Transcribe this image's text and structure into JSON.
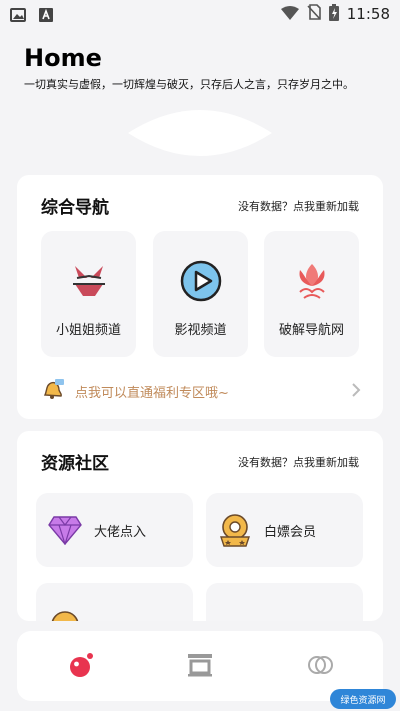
{
  "status_bar": {
    "time": "11:58",
    "icons": [
      "image-icon",
      "a-letter-icon",
      "wifi-icon",
      "no-sim-icon",
      "battery-charging-icon"
    ]
  },
  "header": {
    "title": "Home",
    "subtitle": "一切真实与虚假，一切辉煌与破灭，只存后人之言，只存岁月之中。"
  },
  "nav_card": {
    "title": "综合导航",
    "reload_link": "没有数据？点我重新加载",
    "tiles": [
      {
        "label": "小姐姐频道",
        "icon": "bikini-icon"
      },
      {
        "label": "影视频道",
        "icon": "play-icon"
      },
      {
        "label": "破解导航网",
        "icon": "lotus-icon"
      }
    ],
    "promo_text": "点我可以直通福利专区哦~"
  },
  "resource_card": {
    "title": "资源社区",
    "reload_link": "没有数据？点我重新加载",
    "items": [
      {
        "label": "大佬点入",
        "icon": "diamond-icon"
      },
      {
        "label": "白嫖会员",
        "icon": "vip-badge-icon"
      }
    ]
  },
  "tab_bar": {
    "tabs": [
      {
        "icon": "home-dot-icon",
        "active": true
      },
      {
        "icon": "archive-icon",
        "active": false
      },
      {
        "icon": "circles-icon",
        "active": false
      }
    ]
  },
  "watermark": "绿色资源网",
  "colors": {
    "accent": "#e8344f",
    "promo": "#c08a5a",
    "background": "#f4f4f6"
  }
}
